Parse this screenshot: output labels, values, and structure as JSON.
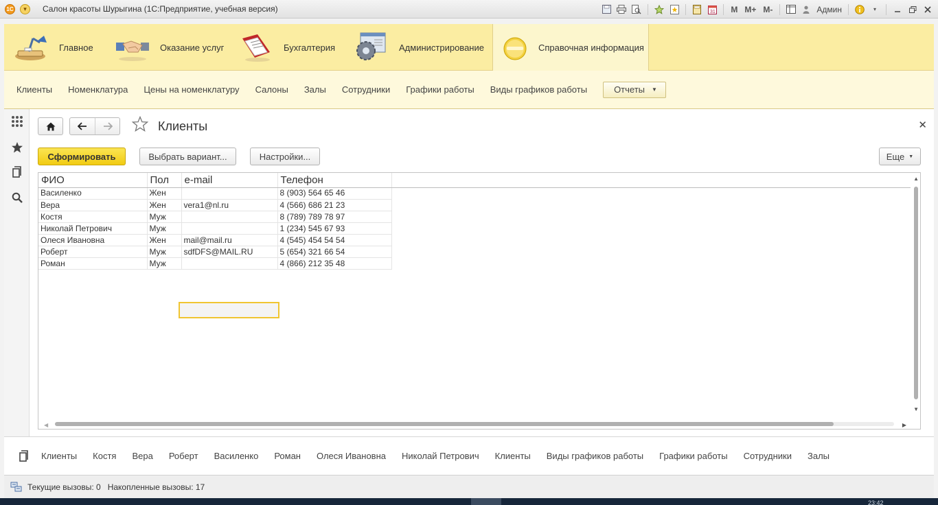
{
  "window": {
    "title": "Салон красоты Шурыгина  (1С:Предприятие, учебная версия)",
    "user": "Админ",
    "memory_buttons": [
      "M",
      "M+",
      "M-"
    ]
  },
  "sections": [
    {
      "label": "Главное",
      "icon": "desk-lamp-icon"
    },
    {
      "label": "Оказание услуг",
      "icon": "handshake-icon"
    },
    {
      "label": "Бухгалтерия",
      "icon": "ledger-book-icon"
    },
    {
      "label": "Администрирование",
      "icon": "gear-window-icon"
    },
    {
      "label": "Справочная информация",
      "icon": "info-disc-icon",
      "active": true
    }
  ],
  "nav": {
    "items": [
      "Клиенты",
      "Номенклатура",
      "Цены на номенклатуру",
      "Салоны",
      "Залы",
      "Сотрудники",
      "Графики работы",
      "Виды графиков работы"
    ],
    "reports_label": "Отчеты"
  },
  "form": {
    "title": "Клиенты",
    "generate_label": "Сформировать",
    "choose_variant_label": "Выбрать вариант...",
    "settings_label": "Настройки...",
    "more_label": "Еще"
  },
  "report": {
    "columns": [
      "ФИО",
      "Пол",
      "e-mail",
      "Телефон"
    ],
    "rows": [
      [
        "Василенко",
        "Жен",
        "",
        "8 (903) 564 65 46"
      ],
      [
        "Вера",
        "Жен",
        "vera1@nl.ru",
        "4 (566) 686 21 23"
      ],
      [
        "Костя",
        "Муж",
        "",
        "8 (789) 789 78 97"
      ],
      [
        "Николай Петрович",
        "Муж",
        "",
        "1 (234) 545 67 93"
      ],
      [
        "Олеся Ивановна",
        "Жен",
        "mail@mail.ru",
        "4 (545) 454 54 54"
      ],
      [
        "Роберт",
        "Муж",
        "sdfDFS@MAIL.RU",
        "5 (654) 321 66 54"
      ],
      [
        "Роман",
        "Муж",
        "",
        "4 (866) 212 35 48"
      ]
    ]
  },
  "history": [
    "Клиенты",
    "Костя",
    "Вера",
    "Роберт",
    "Василенко",
    "Роман",
    "Олеся Ивановна",
    "Николай Петрович",
    "Клиенты",
    "Виды графиков работы",
    "Графики работы",
    "Сотрудники",
    "Залы"
  ],
  "status": {
    "current_calls": "Текущие вызовы: 0",
    "accumulated_calls": "Накопленные вызовы: 17"
  },
  "taskbar": {
    "clock": "23:42"
  },
  "colors": {
    "accent": "#f1cb13",
    "sections_bg": "#fbeda2",
    "nav_bg": "#fef9dc"
  }
}
